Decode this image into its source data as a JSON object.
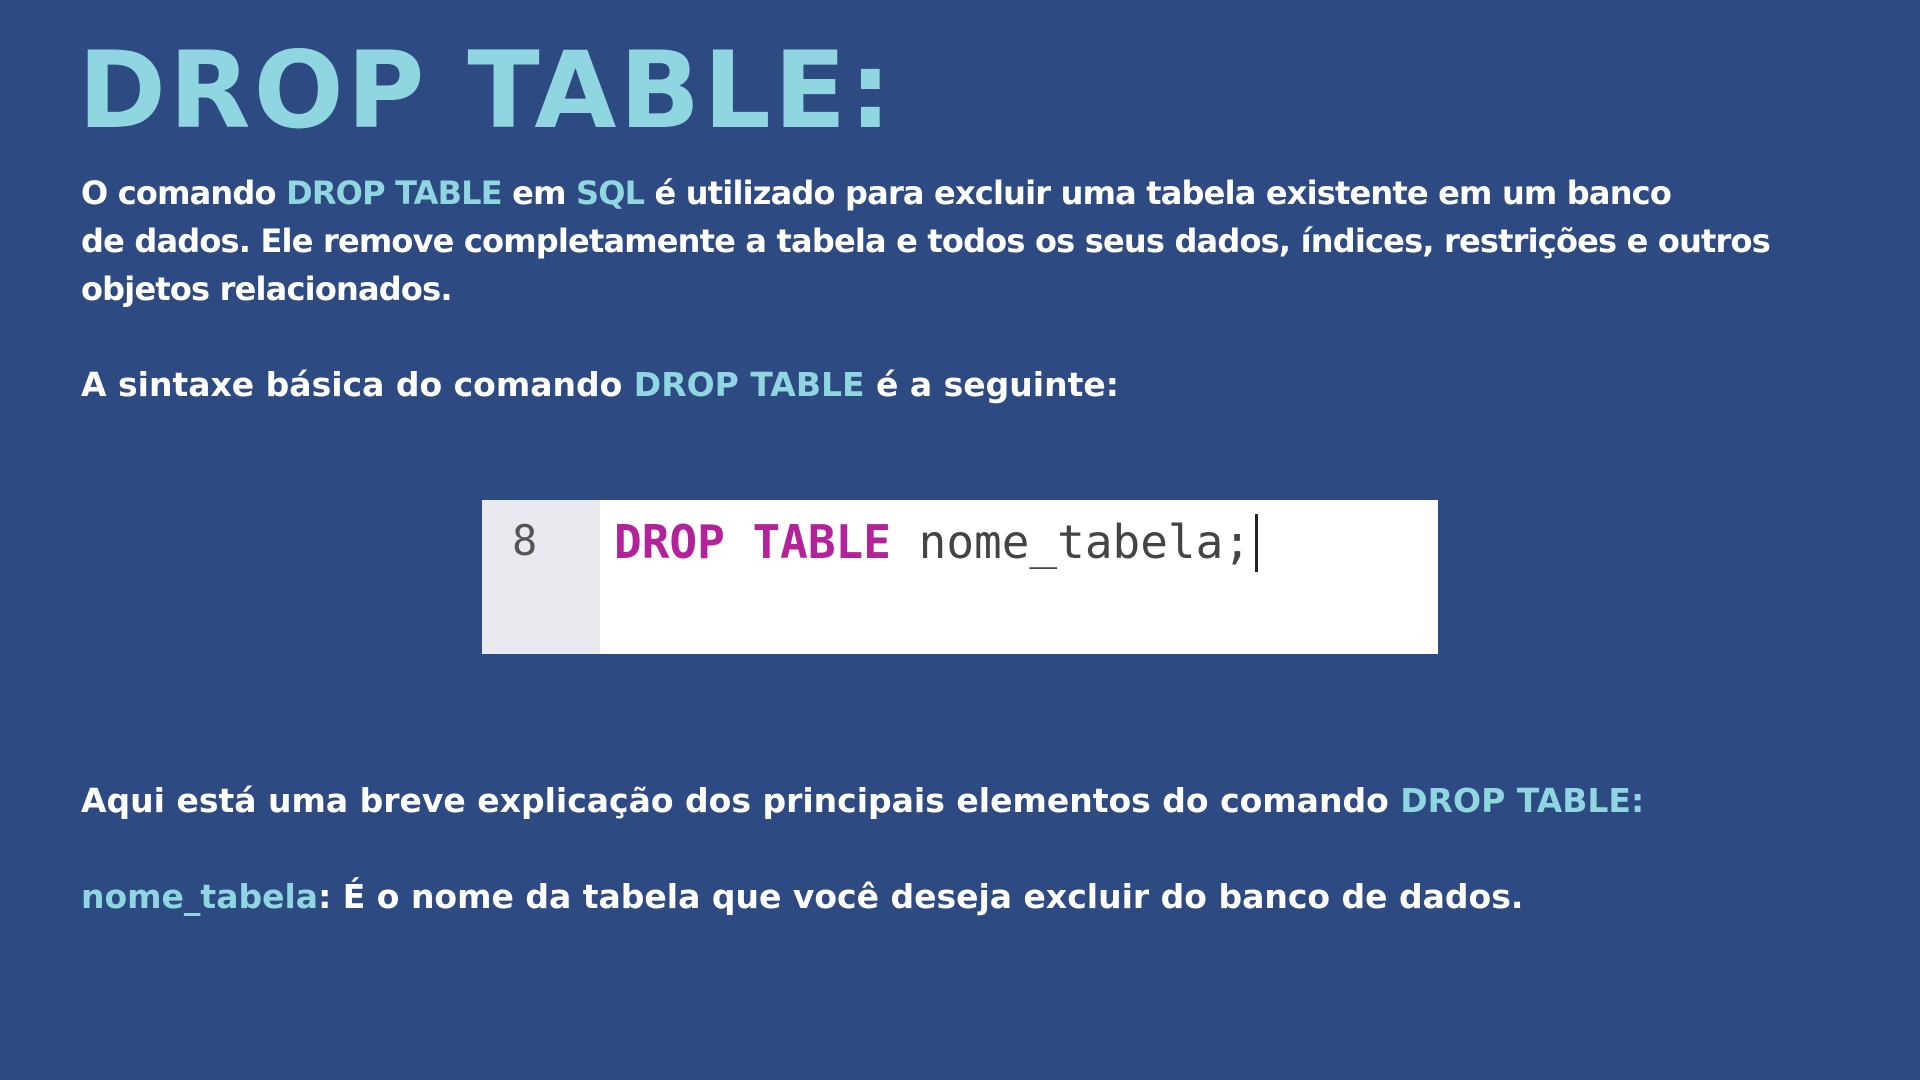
{
  "title": "DROP TABLE:",
  "intro": {
    "t1": "O comando ",
    "h1": "DROP TABLE",
    "t2": " em ",
    "h2": "SQL",
    "t3": " é utilizado para excluir uma tabela existente em um banco",
    "line2": "de dados. Ele remove completamente a tabela e todos os seus dados, índices, restrições e outros",
    "line3": "objetos relacionados."
  },
  "syntax": {
    "t1": "A sintaxe básica do comando ",
    "h1": "DROP TABLE",
    "t2": " é a seguinte:"
  },
  "code": {
    "line_number": "8",
    "keyword": "DROP TABLE",
    "rest": " nome_tabela;"
  },
  "explanation": {
    "t1": "Aqui está uma breve explicação dos principais elementos do comando ",
    "h1": "DROP TABLE:"
  },
  "param": {
    "name": "nome_tabela",
    "desc": ": É o nome da tabela que você deseja excluir do banco de dados."
  },
  "colors": {
    "background": "#2d4a82",
    "highlight": "#8fd6e0",
    "text": "#ffffff",
    "keyword": "#b3229a"
  }
}
